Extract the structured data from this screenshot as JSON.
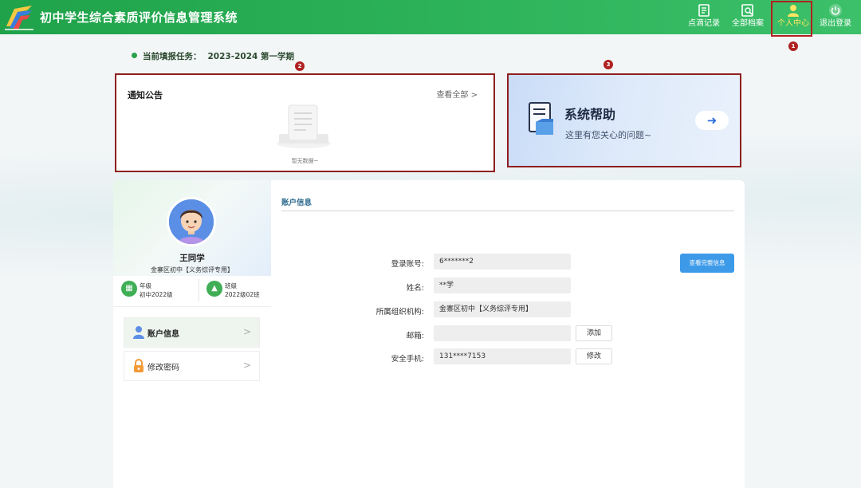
{
  "header": {
    "app_title": "初中学生综合素质评价信息管理系统",
    "nav": [
      {
        "label": "点滴记录",
        "icon": "notebook-icon"
      },
      {
        "label": "全部档案",
        "icon": "archive-search-icon"
      },
      {
        "label": "个人中心",
        "icon": "user-icon",
        "active": true
      },
      {
        "label": "退出登录",
        "icon": "power-icon"
      }
    ]
  },
  "markers": [
    "1",
    "2",
    "3"
  ],
  "task": {
    "label": "当前填报任务：",
    "value": "2023-2024 第一学期"
  },
  "notice": {
    "title": "通知公告",
    "view_all": "查看全部 >",
    "empty_text": "暂无数据~"
  },
  "help": {
    "title": "系统帮助",
    "subtitle": "这里有您关心的问题~"
  },
  "profile": {
    "name": "王同学",
    "school": "金寨区初中【义务综评专用】",
    "grade_label": "年级",
    "grade_value": "初中2022级",
    "class_label": "班级",
    "class_value": "2022级02班",
    "menu": [
      {
        "label": "账户信息",
        "icon": "user-icon",
        "active": true
      },
      {
        "label": "修改密码",
        "icon": "lock-icon",
        "active": false
      }
    ],
    "menu_arrow": ">"
  },
  "account": {
    "title": "账户信息",
    "view_full_button": "查看完整信息",
    "fields": [
      {
        "label": "登录账号:",
        "value": "6*******2"
      },
      {
        "label": "姓名:",
        "value": "**学"
      },
      {
        "label": "所属组织机构:",
        "value": "金寨区初中【义务综评专用】"
      },
      {
        "label": "邮箱:",
        "value": "",
        "button": "添加"
      },
      {
        "label": "安全手机:",
        "value": "131****7153",
        "button": "修改"
      }
    ]
  },
  "colors": {
    "header_green": "#2db35a",
    "active_nav": "#ffe463",
    "highlight_border": "#8e1f1f",
    "primary_button": "#3d9ae8",
    "account_title": "#2f6c8f"
  }
}
